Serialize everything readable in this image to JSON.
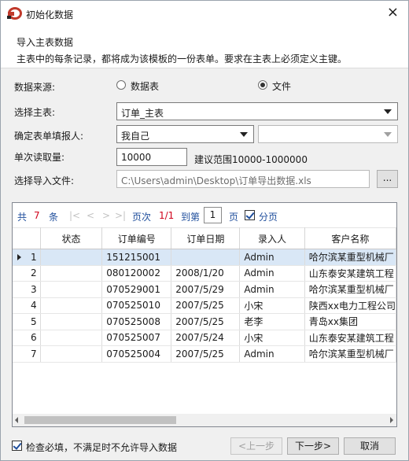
{
  "window": {
    "title": "初始化数据",
    "close_glyph": "×"
  },
  "header": {
    "title": "导入主表数据",
    "description": "主表中的每条记录，都将成为该模板的一份表单。要求在主表上必须定义主键。"
  },
  "form": {
    "source_label": "数据来源:",
    "source_option_table": "数据表",
    "source_option_file": "文件",
    "source_selected": "文件",
    "main_table_label": "选择主表:",
    "main_table_value": "订单_主表",
    "filler_label": "确定表单填报人:",
    "filler_value": "我自己",
    "filler_second_value": "",
    "batch_label": "单次读取量:",
    "batch_value": "10000",
    "batch_hint": "建议范围10000-1000000",
    "file_label": "选择导入文件:",
    "file_value": "C:\\Users\\admin\\Desktop\\订单导出数据.xls",
    "browse_label": "..."
  },
  "pager": {
    "total_prefix": "共",
    "total_count": "7",
    "total_suffix": "条",
    "first": "|<",
    "prev": "<",
    "next": ">",
    "last": ">|",
    "page_label": "页次",
    "page_current": "1/1",
    "goto_label": "到第",
    "goto_value": "1",
    "page_suffix": "页",
    "paging_label": "分页",
    "paging_checked": true
  },
  "grid": {
    "columns": [
      "",
      "状态",
      "订单编号",
      "订单日期",
      "录入人",
      "客户名称"
    ],
    "rows": [
      [
        "1",
        "",
        "151215001",
        "",
        "Admin",
        "哈尔滨某重型机械厂"
      ],
      [
        "2",
        "",
        "080120002",
        "2008/1/20",
        "Admin",
        "山东泰安某建筑工程"
      ],
      [
        "3",
        "",
        "070529001",
        "2007/5/29",
        "Admin",
        "哈尔滨某重型机械厂"
      ],
      [
        "4",
        "",
        "070525010",
        "2007/5/25",
        "小宋",
        "陕西xx电力工程公司"
      ],
      [
        "5",
        "",
        "070525008",
        "2007/5/25",
        "老李",
        "青岛xx集团"
      ],
      [
        "6",
        "",
        "070525007",
        "2007/5/24",
        "小宋",
        "山东泰安某建筑工程"
      ],
      [
        "7",
        "",
        "070525004",
        "2007/5/25",
        "Admin",
        "哈尔滨某重型机械厂"
      ]
    ],
    "selected_row": 0
  },
  "footer": {
    "check_label": "检查必填，不满足时不允许导入数据",
    "check_checked": true,
    "prev_button": "<上一步",
    "next_button": "下一步>",
    "cancel_button": "取消"
  },
  "colors": {
    "accent_blue": "#1f4e9c",
    "count_red": "#d0021b",
    "selected_row": "#d9e7f6",
    "logo_red": "#c0392b"
  }
}
